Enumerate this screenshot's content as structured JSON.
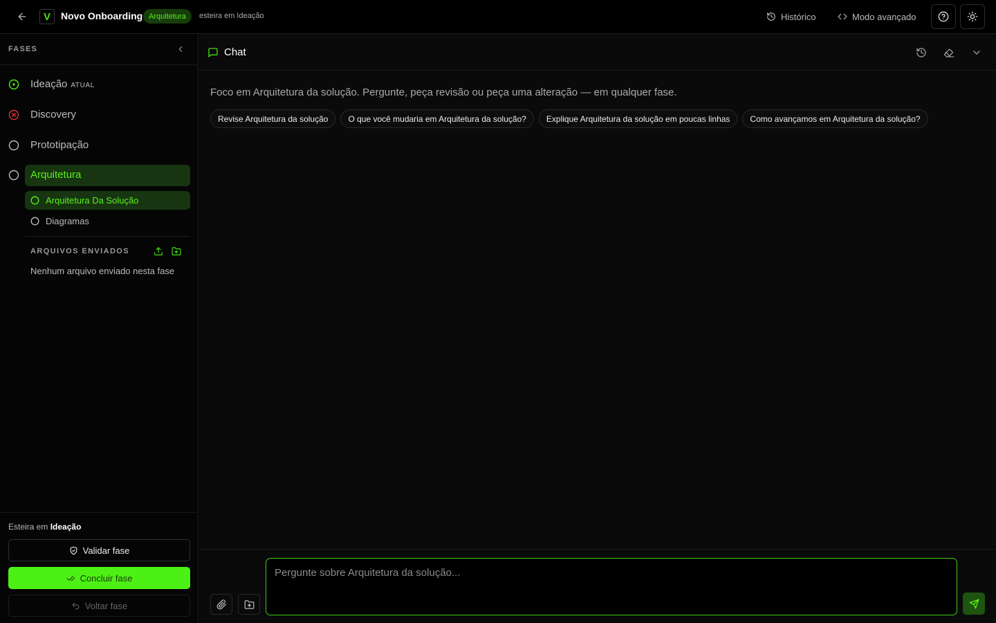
{
  "topbar": {
    "logo_letter": "V",
    "title": "Novo Onboarding",
    "phase_badge": "Arquitetura",
    "phase_sub": "esteira em Ideação",
    "history_label": "Histórico",
    "advanced_label": "Modo avançado"
  },
  "sidebar": {
    "title": "FASES",
    "phases": [
      {
        "label": "Ideação",
        "tag": "ATUAL",
        "status": "current"
      },
      {
        "label": "Discovery",
        "tag": "",
        "status": "error"
      },
      {
        "label": "Prototipação",
        "tag": "",
        "status": "pending"
      },
      {
        "label": "Arquitetura",
        "tag": "",
        "status": "active"
      }
    ],
    "subphases": [
      {
        "label": "Arquitetura Da Solução",
        "active": true
      },
      {
        "label": "Diagramas",
        "active": false
      }
    ],
    "files": {
      "title": "ARQUIVOS ENVIADOS",
      "empty": "Nenhum arquivo enviado nesta fase"
    },
    "footer": {
      "esteira_prefix": "Esteira em",
      "esteira_value": "Ideação",
      "validate_label": "Validar fase",
      "conclude_label": "Concluir fase",
      "back_label": "Voltar fase"
    }
  },
  "chat": {
    "title": "Chat",
    "intro": "Foco em Arquitetura da solução. Pergunte, peça revisão ou peça uma alteração — em qualquer fase.",
    "suggestions": [
      "Revise Arquitetura da solução",
      "O que você mudaria em Arquitetura da solução?",
      "Explique Arquitetura da solução em poucas linhas",
      "Como avançamos em Arquitetura da solução?"
    ],
    "input_placeholder": "Pergunte sobre Arquitetura da solução..."
  },
  "colors": {
    "accent": "#4df014",
    "accent_text": "#5cf021",
    "active_bg": "#163510",
    "error": "#e0343a",
    "background": "#000000"
  },
  "icons": {
    "back": "arrow-left-icon",
    "history": "history-icon",
    "advanced": "code-icon",
    "help": "help-circle-icon",
    "theme": "sun-icon",
    "collapse": "chevron-left-icon",
    "upload": "upload-icon",
    "folder": "folder-upload-icon",
    "chat": "message-square-icon",
    "clear": "eraser-icon",
    "expand": "chevron-down-icon",
    "attach": "paperclip-icon",
    "send": "send-icon"
  }
}
